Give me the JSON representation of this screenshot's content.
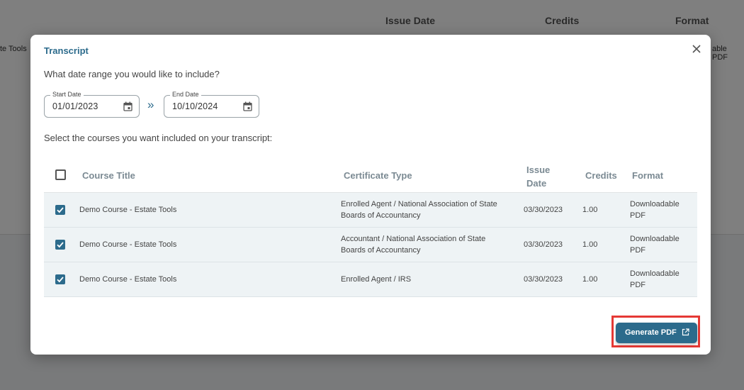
{
  "background": {
    "columns": [
      "Issue Date",
      "Credits",
      "Format"
    ],
    "row_title_fragment": "te Tools",
    "row_format_fragment": "able PDF"
  },
  "modal": {
    "title": "Transcript",
    "date_prompt": "What date range you would like to include?",
    "start_date": {
      "label": "Start Date",
      "value": "01/01/2023",
      "icon": "calendar-icon"
    },
    "end_date": {
      "label": "End Date",
      "value": "10/10/2024",
      "icon": "calendar-icon"
    },
    "range_separator": "»",
    "select_prompt": "Select the courses you want included on your transcript:",
    "table": {
      "headers": [
        "Course Title",
        "Certificate Type",
        "Issue Date",
        "Credits",
        "Format"
      ],
      "rows": [
        {
          "checked": true,
          "title": "Demo Course - Estate Tools",
          "certificate": "Enrolled Agent / National Association of State Boards of Accountancy",
          "issue_date": "03/30/2023",
          "credits": "1.00",
          "format": "Downloadable PDF"
        },
        {
          "checked": true,
          "title": "Demo Course - Estate Tools",
          "certificate": "Accountant / National Association of State Boards of Accountancy",
          "issue_date": "03/30/2023",
          "credits": "1.00",
          "format": "Downloadable PDF"
        },
        {
          "checked": true,
          "title": "Demo Course - Estate Tools",
          "certificate": "Enrolled Agent / IRS",
          "issue_date": "03/30/2023",
          "credits": "1.00",
          "format": "Downloadable PDF"
        }
      ]
    },
    "generate_button": {
      "label": "Generate PDF",
      "icon": "external-link-icon"
    },
    "colors": {
      "accent": "#2c6b8c",
      "highlight": "#e53935"
    }
  }
}
